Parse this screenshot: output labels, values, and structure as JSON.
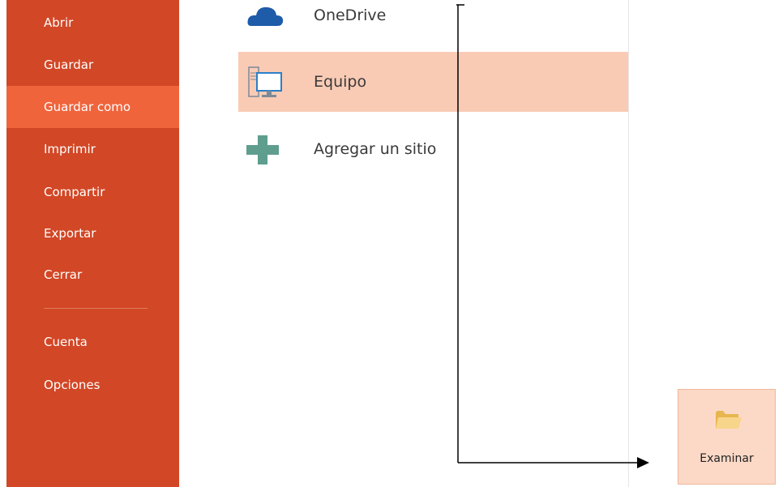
{
  "sidebar": {
    "accent_color": "#d24726",
    "active_color": "#f0643c",
    "items": [
      {
        "label": "Abrir"
      },
      {
        "label": "Guardar"
      },
      {
        "label": "Guardar como",
        "active": true
      },
      {
        "label": "Imprimir"
      },
      {
        "label": "Compartir"
      },
      {
        "label": "Exportar"
      },
      {
        "label": "Cerrar"
      },
      {
        "label": "Cuenta"
      },
      {
        "label": "Opciones"
      }
    ]
  },
  "places": {
    "items": [
      {
        "label": "OneDrive",
        "icon": "cloud-icon"
      },
      {
        "label": "Equipo",
        "icon": "computer-icon",
        "selected": true
      },
      {
        "label": "Agregar un sitio",
        "icon": "plus-icon"
      }
    ]
  },
  "browse": {
    "label": "Examinar",
    "icon": "folder-icon"
  }
}
